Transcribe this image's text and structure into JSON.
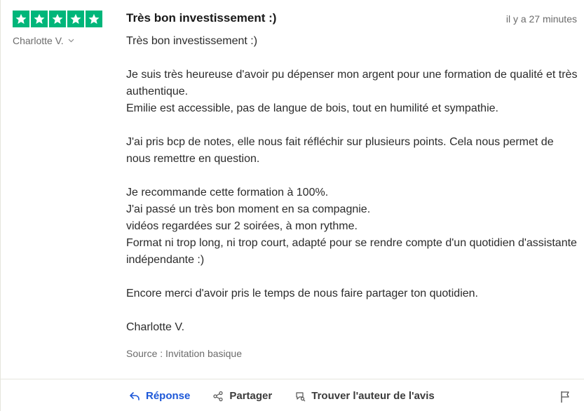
{
  "review": {
    "rating": 5,
    "author": "Charlotte V.",
    "title": "Très bon investissement :)",
    "time": "il y a 27 minutes",
    "body": [
      "Très bon investissement :)",
      "",
      "Je suis très heureuse d'avoir pu dépenser mon argent pour une formation de qualité et très authentique.",
      "Emilie est accessible, pas de langue de bois, tout en humilité et sympathie.",
      "",
      "J'ai pris bcp de notes, elle nous fait réfléchir sur plusieurs points. Cela nous permet de nous remettre en question.",
      "",
      "Je recommande cette formation à 100%.",
      "J'ai passé un très bon moment en sa compagnie.",
      "vidéos regardées sur 2 soirées, à mon rythme.",
      "Format ni trop long, ni trop court, adapté pour se rendre compte d'un quotidien d'assistante indépendante :)",
      "",
      "Encore merci d'avoir pris le temps de nous faire partager ton quotidien.",
      "",
      "Charlotte V."
    ],
    "source": "Source : Invitation basique"
  },
  "actions": {
    "reply_label": "Réponse",
    "share_label": "Partager",
    "find_author_label": "Trouver l'auteur de l'avis"
  },
  "colors": {
    "star_green": "#00b67a",
    "reply_blue": "#1c57d8"
  },
  "icons": {
    "star": "star-icon",
    "chevron": "chevron-down-icon",
    "reply": "reply-icon",
    "share": "share-icon",
    "find_author": "find-author-icon",
    "flag": "flag-icon"
  }
}
